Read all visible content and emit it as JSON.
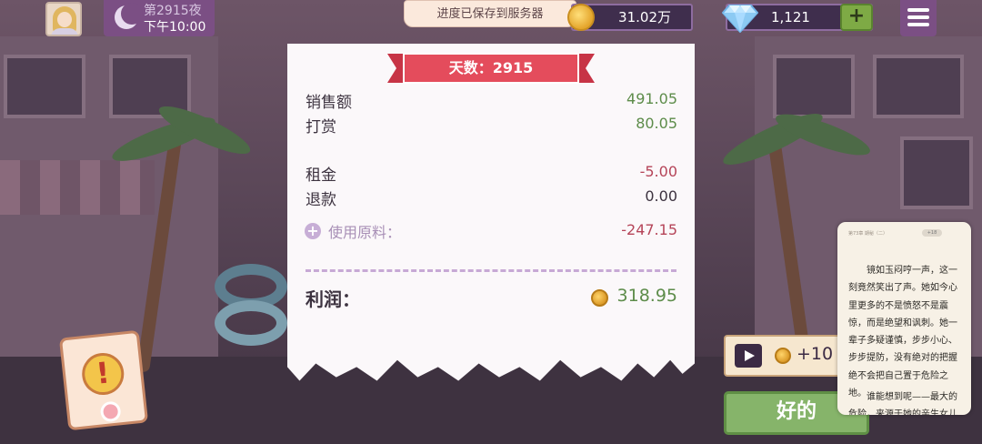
{
  "hud": {
    "night_label": "第2915夜",
    "time_label": "下午10:00",
    "save_toast": "进度已保存到服务器",
    "money": "31.02万",
    "gems": "1,121",
    "plus_label": "+",
    "icons": [
      "avatar",
      "moon-icon",
      "coin-icon",
      "gem-icon",
      "menu-icon"
    ]
  },
  "receipt": {
    "ribbon_title": "天数：2915",
    "rows": [
      {
        "label": "销售额",
        "value": "491.05"
      },
      {
        "label": "打赏",
        "value": "80.05"
      },
      {
        "label": "租金",
        "value": "-5.00"
      },
      {
        "label": "退款",
        "value": "0.00"
      }
    ],
    "ingredients_label": "使用原料：",
    "ingredients_value": "-247.15",
    "profit_label": "利润：",
    "profit_value": "318.95"
  },
  "actions": {
    "ad_reward": "+10",
    "ok_label": "好的"
  },
  "reader": {
    "header": "第73章  期秘（二）",
    "pill": "+18",
    "paragraph1": "镜如玉闷哼一声，这一刻竟然笑出了声。她如今心里更多的不是愤怒不是震惊，而是绝望和讽刺。她一辈子多疑谨慎，步步小心、步步提防，没有绝对的把握绝不会把自己置于危险之地。",
    "paragraph2": "谁能想到呢——最大的危险，来源于她的亲生女儿"
  },
  "colors": {
    "positive": "#5d8c4a",
    "negative": "#b54458",
    "accent_purple": "#7b4f84",
    "ribbon_red": "#e44c5c",
    "ok_green": "#86b46a"
  }
}
